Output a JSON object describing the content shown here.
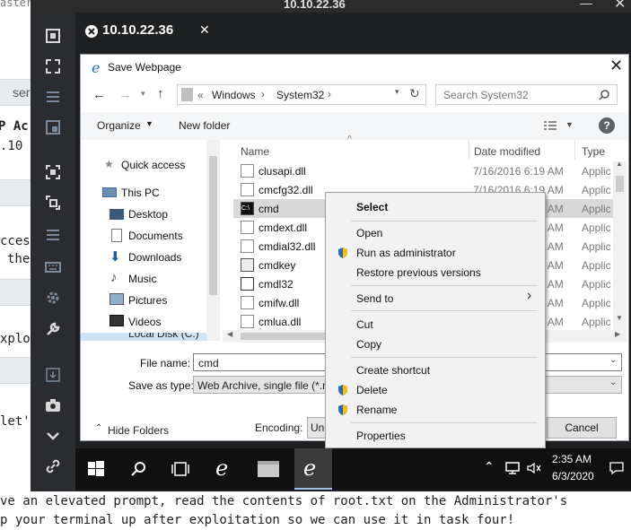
{
  "background_page": {
    "lines": [
      "aster",
      "ser",
      "P Ac",
      ".10",
      "ccess",
      "the",
      "xplo",
      "let'",
      "ve an elevated prompt, read the contents of root.txt on the Administrator's",
      "p your terminal up after exploitation so we can use it in task four!"
    ]
  },
  "client": {
    "window_title": "10.10.22.36",
    "tab_label": "10.10.22.36",
    "sidebar_icons": [
      "fullscreen-icon",
      "expand-icon",
      "menu-icon",
      "window-icon",
      "screen-icon",
      "resize-icon",
      "menu-icon",
      "keyboard-icon",
      "settings-icon",
      "wrench-icon",
      "import-icon",
      "camera-icon",
      "chevron-down-icon",
      "link-icon"
    ]
  },
  "dialog": {
    "title": "Save Webpage",
    "breadcrumb": [
      "Windows",
      "System32"
    ],
    "breadcrumb_prefix": "«",
    "search_placeholder": "Search System32",
    "organize_label": "Organize",
    "new_folder_label": "New folder",
    "nav": {
      "quick_access": "Quick access",
      "this_pc": "This PC",
      "items": [
        "Desktop",
        "Documents",
        "Downloads",
        "Music",
        "Pictures",
        "Videos"
      ],
      "local_disk": "Local Disk (C:)"
    },
    "columns": {
      "name": "Name",
      "date": "Date modified",
      "type": "Type"
    },
    "files": [
      {
        "name": "clusapi.dll",
        "date": "7/16/2016 6:19 AM",
        "type": "Applic"
      },
      {
        "name": "cmcfg32.dll",
        "date": "7/16/2016 6:19 AM",
        "type": "Applic"
      },
      {
        "name": "cmd",
        "date": "7/16/2016 6:19 AM",
        "type": "Applic"
      },
      {
        "name": "cmdext.dll",
        "date": "7/16/2016 6:19 AM",
        "type": "Applic"
      },
      {
        "name": "cmdial32.dll",
        "date": "7/16/2016 6:19 AM",
        "type": "Applic"
      },
      {
        "name": "cmdkey",
        "date": "7/16/2016 6:19 AM",
        "type": "Applic"
      },
      {
        "name": "cmdl32",
        "date": "7/16/2016 6:19 AM",
        "type": "Applic"
      },
      {
        "name": "cmifw.dll",
        "date": "7/16/2016 6:19 AM",
        "type": "Applic"
      },
      {
        "name": "cmlua.dll",
        "date": "7/16/2016 6:19 AM",
        "type": "Applic"
      }
    ],
    "file_name_label": "File name:",
    "file_name_value": "cmd",
    "save_as_label": "Save as type:",
    "save_as_value": "Web Archive, single file (*.m",
    "hide_folders": "Hide Folders",
    "encoding_label": "Encoding:",
    "encoding_value": "Un",
    "cancel_label": "Cancel"
  },
  "context_menu": {
    "select": "Select",
    "open": "Open",
    "run_as_admin": "Run as administrator",
    "restore": "Restore previous versions",
    "send_to": "Send to",
    "cut": "Cut",
    "copy": "Copy",
    "create_shortcut": "Create shortcut",
    "delete": "Delete",
    "rename": "Rename",
    "properties": "Properties"
  },
  "taskbar": {
    "time": "2:35 AM",
    "date": "6/3/2020"
  }
}
